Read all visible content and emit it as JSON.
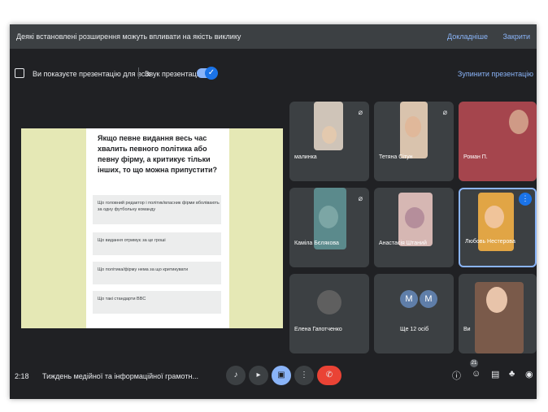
{
  "notice": {
    "message": "Деякі встановлені розширення можуть впливати на якість виклику",
    "more": "Докладніше",
    "close": "Закрити"
  },
  "presentation": {
    "status": "Ви показуєте презентацію для всіх",
    "sound": "Звук презентації",
    "stop": "Зупинити презентацію"
  },
  "slide": {
    "question": "Якщо певне видання весь час хвалить певного політика або певну фірму, а критикує тільки інших, то що можна припустити?",
    "options": [
      "Що головний редактор і політик/власник фірми вболівають за одну футбольну команду",
      "Що видання отримує за це гроші",
      "Що політика/фірму нема за що критикувати",
      "Що такі стандарти BBC"
    ]
  },
  "participants": [
    {
      "name": "малинка"
    },
    {
      "name": "Тетяна Сітун"
    },
    {
      "name": "Роман П."
    },
    {
      "name": "Каміла Бєлякова"
    },
    {
      "name": "Анастасія Штаний"
    },
    {
      "name": "Любовь Нестерова"
    },
    {
      "name": "Елена Гапотченко"
    },
    {
      "name": "Ще 12 осіб",
      "initials": [
        "M",
        "M"
      ]
    },
    {
      "name": "Ви"
    }
  ],
  "bottom": {
    "time": "2:18",
    "meeting_title": "Тиждень медійної та інформаційної грамотн...",
    "participants_count": "21"
  },
  "colors": {
    "background": "#202124",
    "accent": "#8ab4f8",
    "end_call": "#ea4335",
    "slide_bg": "#e5e8b5"
  }
}
